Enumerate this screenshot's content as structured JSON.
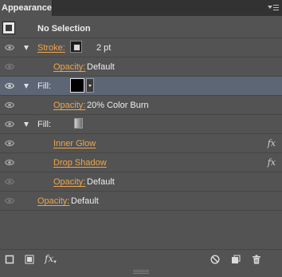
{
  "panel": {
    "tab_label": "Appearance",
    "selection_label": "No Selection"
  },
  "rows": {
    "stroke": {
      "label": "Stroke:",
      "value": "2 pt"
    },
    "stroke_opacity": {
      "label": "Opacity:",
      "value": "Default"
    },
    "fill1": {
      "label": "Fill:"
    },
    "fill1_opacity": {
      "label": "Opacity:",
      "value": "20% Color Burn"
    },
    "fill2": {
      "label": "Fill:"
    },
    "inner_glow": {
      "label": "Inner Glow",
      "icon": "fx-icon"
    },
    "drop_shadow": {
      "label": "Drop Shadow",
      "icon": "fx-icon"
    },
    "fill2_opacity": {
      "label": "Opacity:",
      "value": "Default"
    },
    "object_opacity": {
      "label": "Opacity:",
      "value": "Default"
    }
  },
  "footer": {
    "fx_label": "fx",
    "icons": [
      "add-new-stroke-icon",
      "add-new-fill-icon",
      "add-new-effect-icon",
      "clear-appearance-icon",
      "duplicate-item-icon",
      "delete-item-icon"
    ]
  },
  "colors": {
    "panel_bg": "#535353",
    "selected_row": "#5c6675",
    "link_orange": "#f0a64b"
  }
}
